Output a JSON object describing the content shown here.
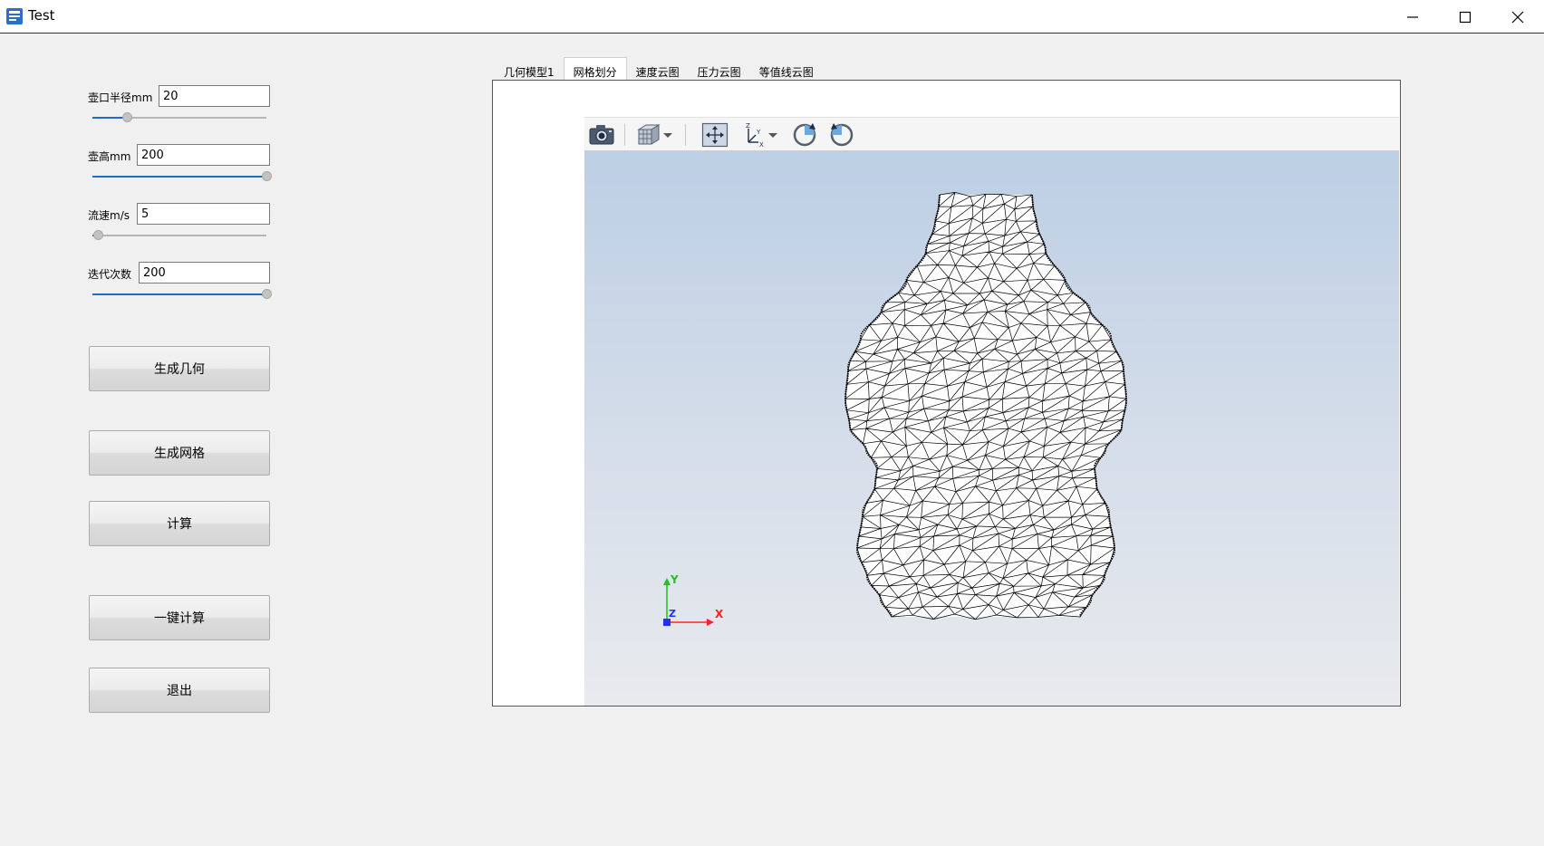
{
  "window": {
    "title": "Test"
  },
  "params": [
    {
      "label": "壶口半径mm",
      "value": "20",
      "slider_fraction": 0.2
    },
    {
      "label": "壶高mm",
      "value": "200",
      "slider_fraction": 1.0
    },
    {
      "label": "流速m/s",
      "value": "5",
      "slider_fraction": 0.03
    },
    {
      "label": "迭代次数",
      "value": "200",
      "slider_fraction": 1.0
    }
  ],
  "buttons": {
    "generate_geometry": "生成几何",
    "generate_mesh": "生成网格",
    "compute": "计算",
    "one_click": "一键计算",
    "exit": "退出"
  },
  "tabs": [
    "几何模型1",
    "网格划分",
    "速度云图",
    "压力云图",
    "等值线云图"
  ],
  "active_tab": "网格划分",
  "axes": {
    "x": "X",
    "y": "Y",
    "z": "Z"
  },
  "colors": {
    "accent": "#1b6ec2",
    "viewport_top": "#bccfe4",
    "viewport_bottom": "#e8eaee",
    "axis_x": "#ff2020",
    "axis_y": "#20c020",
    "axis_z": "#2030ff"
  },
  "icons": [
    "app-icon",
    "minimize-icon",
    "maximize-icon",
    "close-icon",
    "camera-icon",
    "cube-view-icon",
    "fit-view-icon",
    "axes-orient-icon",
    "rotate-cw-icon",
    "rotate-ccw-icon"
  ]
}
